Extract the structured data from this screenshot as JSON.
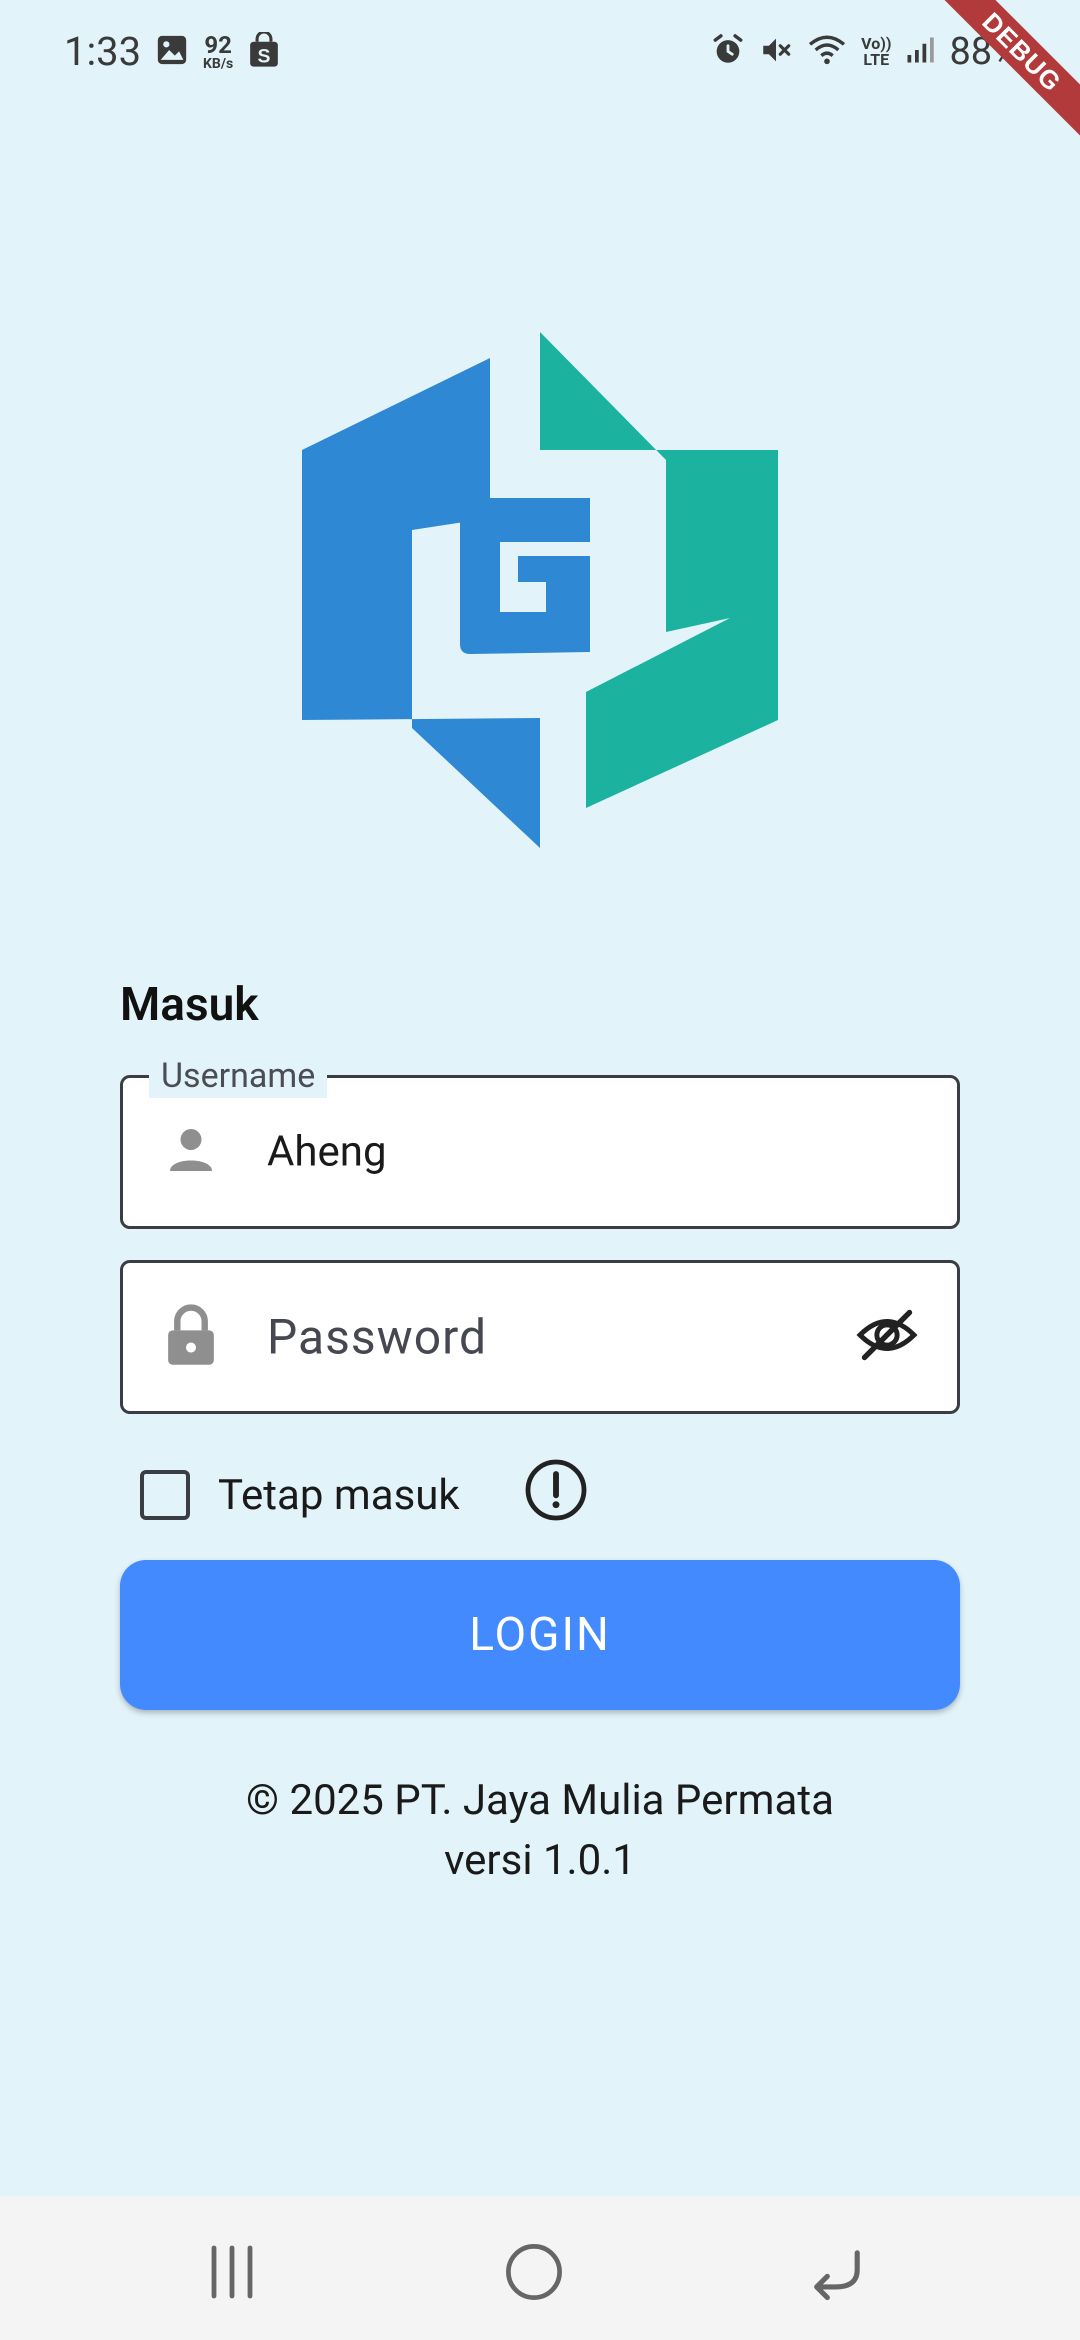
{
  "status_bar": {
    "time": "1:33",
    "net_speed_value": "92",
    "net_speed_unit": "KB/s",
    "network_type": "LTE",
    "volte": "Vo))",
    "battery": "88%"
  },
  "debug_banner": "DEBUG",
  "logo": {
    "letter": "G",
    "colors": {
      "blue": "#2E88D4",
      "teal": "#1BB3A0"
    }
  },
  "form": {
    "title": "Masuk",
    "username": {
      "label": "Username",
      "value": "Aheng",
      "icon": "person-icon"
    },
    "password": {
      "placeholder": "Password",
      "icon": "lock-icon",
      "toggle_icon": "eye-off-icon"
    },
    "remember_label": "Tetap masuk",
    "remember_checked": false,
    "info_icon": "info-icon",
    "login_label": "LOGIN"
  },
  "footer": {
    "copyright": "© 2025 PT. Jaya Mulia Permata",
    "version": "versi 1.0.1"
  },
  "colors": {
    "background": "#E2F4FA",
    "accent": "#448AFF",
    "field_border": "#3A3D44"
  }
}
